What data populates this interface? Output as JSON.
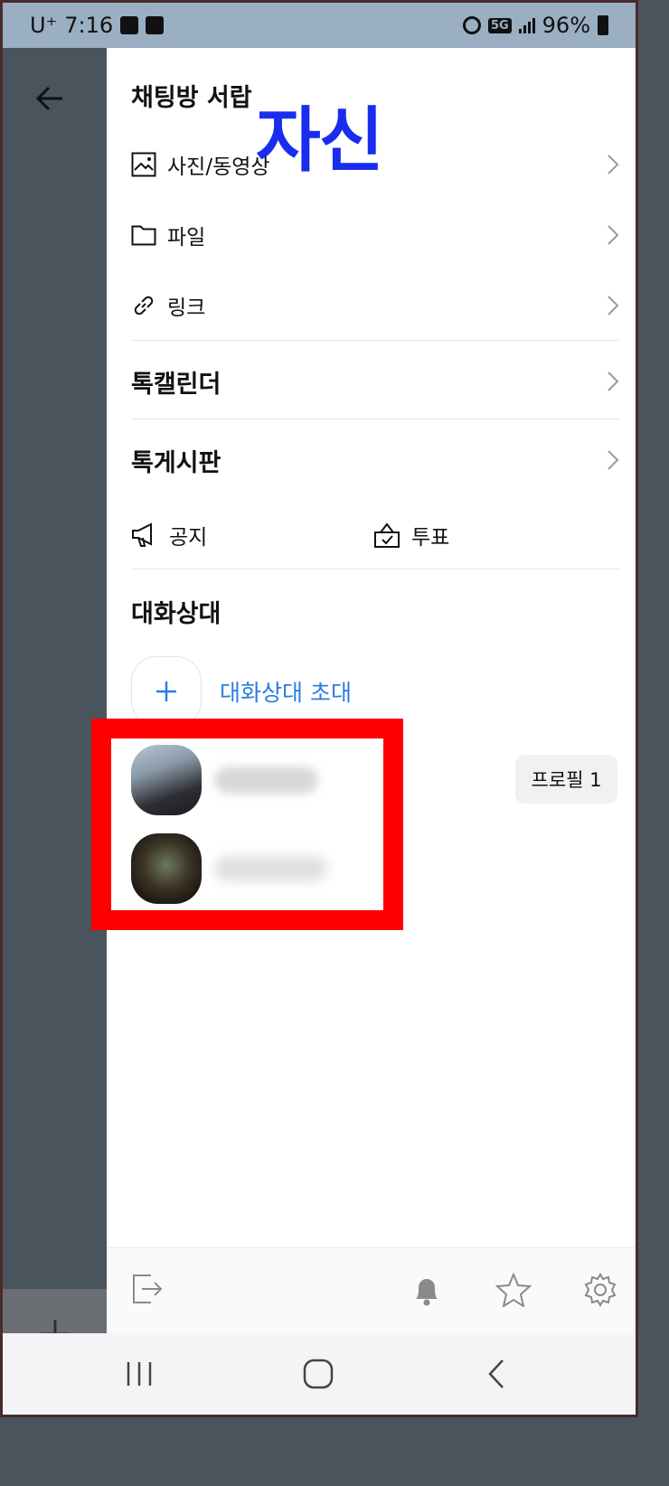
{
  "status_bar": {
    "carrier": "U⁺",
    "time": "7:16",
    "network": "5G",
    "battery": "96%"
  },
  "drawer": {
    "title": "채팅방 서랍",
    "overlay_label": "자신",
    "media_items": [
      {
        "label": "사진/동영상",
        "icon": "image-icon"
      },
      {
        "label": "파일",
        "icon": "folder-icon"
      },
      {
        "label": "링크",
        "icon": "link-icon"
      }
    ],
    "talk_calendar": "톡캘린더",
    "talk_board": "톡게시판",
    "notice": "공지",
    "vote": "투표",
    "members_title": "대화상대",
    "invite_label": "대화상대 초대",
    "profile_button": "프로필 1"
  },
  "colors": {
    "status_bar": "#9aafc2",
    "dim_pane": "#4a545d",
    "invite_blue": "#2b7de0",
    "overlay_blue": "#1a2cf0",
    "highlight_red": "#ff0000"
  }
}
